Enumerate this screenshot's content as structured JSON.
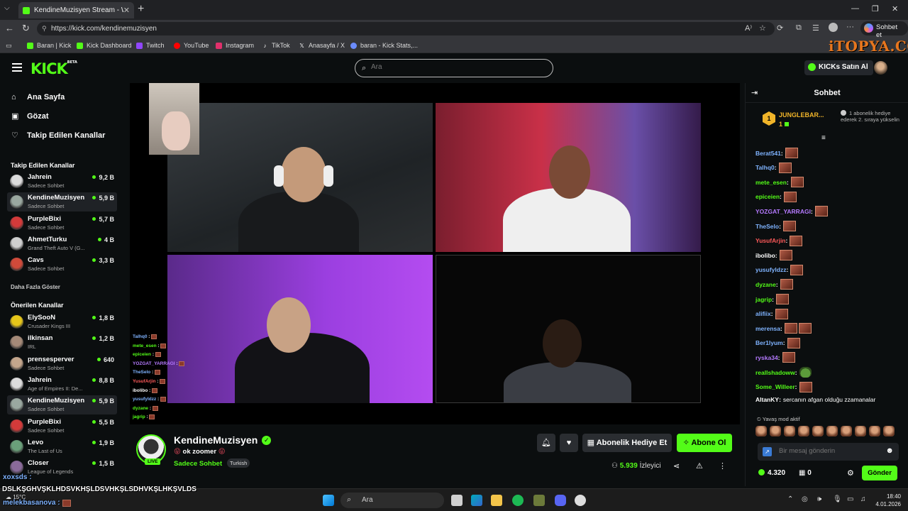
{
  "browser": {
    "tab_title": "KendineMuzisyen Stream - Watch",
    "url": "https://kick.com/kendinemuzisyen",
    "copilot_label": "Sohbet et",
    "bookmarks": [
      {
        "label": "Baran | Kick",
        "color": "#53fc18"
      },
      {
        "label": "Kick Dashboard",
        "color": "#53fc18"
      },
      {
        "label": "Twitch",
        "color": "#9146ff"
      },
      {
        "label": "YouTube",
        "color": "#ff0000"
      },
      {
        "label": "Instagram",
        "color": "#e1306c"
      },
      {
        "label": "TikTok",
        "color": "#ffffff"
      },
      {
        "label": "Anasayfa / X",
        "color": "#ffffff"
      },
      {
        "label": "baran - Kick Stats,...",
        "color": "#6b8cff"
      }
    ]
  },
  "watermark": "iTOPYA.COM",
  "header": {
    "logo": "KICK",
    "logo_badge": "BETA",
    "search_placeholder": "Ara",
    "kicks_button": "KICKs Satın Al"
  },
  "sidebar": {
    "nav": [
      {
        "label": "Ana Sayfa",
        "icon": "home-icon",
        "glyph": "⌂"
      },
      {
        "label": "Gözat",
        "icon": "browse-icon",
        "glyph": "▣"
      },
      {
        "label": "Takip Edilen Kanallar",
        "icon": "heart-icon",
        "glyph": "♡"
      }
    ],
    "followed_header": "Takip Edilen Kanallar",
    "followed": [
      {
        "name": "Jahrein",
        "sub": "Sadece Sohbet",
        "viewers": "9,2 B",
        "color": "#dcdcdc"
      },
      {
        "name": "KendineMuzisyen",
        "sub": "Sadece Sohbet",
        "viewers": "5,9 B",
        "color": "#9aa8a0"
      },
      {
        "name": "PurpleBixi",
        "sub": "Sadece Sohbet",
        "viewers": "5,7 B",
        "color": "#d43a3a"
      },
      {
        "name": "AhmetTurku",
        "sub": "Grand Theft Auto V (G...",
        "viewers": "4 B",
        "color": "#cfcfcf"
      },
      {
        "name": "Cavs",
        "sub": "Sadece Sohbet",
        "viewers": "3,3 B",
        "color": "#d04a3a"
      }
    ],
    "more": "Daha Fazla Göster",
    "recommended_header": "Önerilen Kanallar",
    "recommended": [
      {
        "name": "ElySooN",
        "sub": "Crusader Kings III",
        "viewers": "1,8 B",
        "color": "#e6c619"
      },
      {
        "name": "ilkinsan",
        "sub": "IRL",
        "viewers": "1,2 B",
        "color": "#a58a78"
      },
      {
        "name": "prensesperver",
        "sub": "Sadece Sohbet",
        "viewers": "640",
        "color": "#c4a68c"
      },
      {
        "name": "Jahrein",
        "sub": "Age of Empires II: De...",
        "viewers": "8,8 B",
        "color": "#dcdcdc"
      },
      {
        "name": "KendineMuzisyen",
        "sub": "Sadece Sohbet",
        "viewers": "5,9 B",
        "color": "#9aa8a0"
      },
      {
        "name": "PurpleBixi",
        "sub": "Sadece Sohbet",
        "viewers": "5,5 B",
        "color": "#d43a3a"
      },
      {
        "name": "Levo",
        "sub": "The Last of Us",
        "viewers": "1,9 B",
        "color": "#6aa07a"
      },
      {
        "name": "Closer",
        "sub": "League of Legends",
        "viewers": "1,5 B",
        "color": "#8a6a9a"
      }
    ]
  },
  "video_overlay_chat": [
    {
      "user": "Talhq0",
      "color": "#7fb3ff"
    },
    {
      "user": "mete_esen",
      "color": "#53fc18"
    },
    {
      "user": "epiceien",
      "color": "#53fc18"
    },
    {
      "user": "YOZGAT_YARRAGI",
      "color": "#b57aff"
    },
    {
      "user": "TheSelo",
      "color": "#7fb3ff"
    },
    {
      "user": "YusufArjin",
      "color": "#ff5a5a"
    },
    {
      "user": "ibolibo",
      "color": "#ffffff"
    },
    {
      "user": "yusufyldzz",
      "color": "#7fb3ff"
    },
    {
      "user": "dyzane",
      "color": "#53fc18"
    },
    {
      "user": "jagrip",
      "color": "#53fc18"
    }
  ],
  "stream": {
    "channel": "KendineMuzisyen",
    "live": "LIVE",
    "title": "ok zoomer",
    "title_emote": "😝",
    "category": "Sadece Sohbet",
    "language": "Turkish",
    "gift_button": "Abonelik Hediye Et",
    "subscribe_button": "Abone Ol",
    "viewer_count": "5.939",
    "viewer_label": "İzleyici"
  },
  "chat": {
    "title": "Sohbet",
    "pinned": {
      "name": "JUNGLEBAR...",
      "count": "1",
      "rank": "1",
      "message": "1 abonelik hediye ederek 2. sıraya yükselin"
    },
    "messages": [
      {
        "user": "Berat541",
        "color": "#7fb3ff",
        "emotes": 1
      },
      {
        "user": "Talhq0",
        "color": "#7fb3ff",
        "emotes": 1
      },
      {
        "user": "mete_esen",
        "color": "#53fc18",
        "emotes": 1
      },
      {
        "user": "epiceien",
        "color": "#53fc18",
        "emotes": 1
      },
      {
        "user": "YOZGAT_YARRAGI",
        "color": "#b57aff",
        "emotes": 1
      },
      {
        "user": "TheSelo",
        "color": "#7fb3ff",
        "emotes": 1
      },
      {
        "user": "YusufArjin",
        "color": "#ff5a5a",
        "emotes": 1
      },
      {
        "user": "ibolibo",
        "color": "#ffffff",
        "emotes": 1
      },
      {
        "user": "yusufyldzz",
        "color": "#7fb3ff",
        "emotes": 1
      },
      {
        "user": "dyzane",
        "color": "#53fc18",
        "emotes": 1
      },
      {
        "user": "jagrip",
        "color": "#53fc18",
        "emotes": 1
      },
      {
        "user": "alifiix",
        "color": "#7fb3ff",
        "emotes": 1
      },
      {
        "user": "merensa",
        "color": "#7fb3ff",
        "emotes": 2
      },
      {
        "user": "Ber1lyum",
        "color": "#7fb3ff",
        "emotes": 1
      },
      {
        "user": "ryska34",
        "color": "#b57aff",
        "emotes": 1
      },
      {
        "user": "reallshadoww",
        "color": "#53fc18",
        "emotes": 0,
        "pepe": true
      },
      {
        "user": "Some_Willeer",
        "color": "#53fc18",
        "emotes": 1
      },
      {
        "user": "AltanKY",
        "color": "#ffffff",
        "emotes": 0,
        "text": "sercanın afgan olduğu zzamanalar"
      }
    ],
    "slow_mode": "Yavaş mod aktif",
    "input_placeholder": "Bir mesaj gönderin",
    "kicks_balance": "4.320",
    "gift_balance": "0",
    "send_button": "Gönder"
  },
  "desktop_overlay": {
    "line1": "xoxsds :",
    "line2": "DSLKŞGHVŞKLHDSVKHŞLDSVHKŞLSDHVKŞLHKŞVLDS",
    "line3_user": "melekbasanova :",
    "temp": "15°C"
  },
  "taskbar": {
    "search": "Ara",
    "time": "18:40",
    "date": "4.01.2026"
  }
}
